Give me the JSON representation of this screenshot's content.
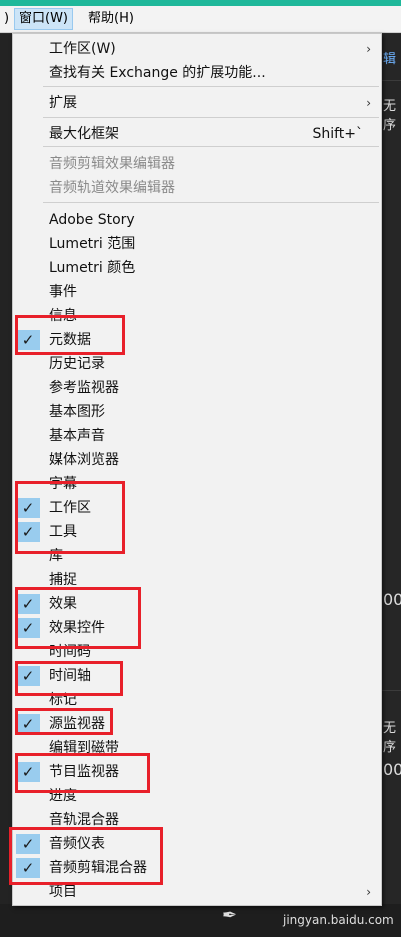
{
  "menubar": {
    "left_fragment": ")",
    "window_menu": "窗口(W)",
    "help_menu": "帮助(H)"
  },
  "background": {
    "right_edge_texts": [
      "辑",
      "无序",
      "00",
      "无序",
      "00"
    ]
  },
  "menu": {
    "items": [
      {
        "label": "工作区(W)",
        "submenu": true
      },
      {
        "label": "查找有关 Exchange 的扩展功能..."
      },
      {
        "label": "扩展",
        "submenu": true
      },
      {
        "label": "最大化框架",
        "shortcut": "Shift+`"
      },
      {
        "label": "音频剪辑效果编辑器",
        "disabled": true
      },
      {
        "label": "音频轨道效果编辑器",
        "disabled": true
      },
      {
        "label": "Adobe Story"
      },
      {
        "label": "Lumetri 范围"
      },
      {
        "label": "Lumetri 颜色"
      },
      {
        "label": "事件"
      },
      {
        "label": "信息"
      },
      {
        "label": "元数据",
        "checked": true
      },
      {
        "label": "历史记录"
      },
      {
        "label": "参考监视器"
      },
      {
        "label": "基本图形"
      },
      {
        "label": "基本声音"
      },
      {
        "label": "媒体浏览器"
      },
      {
        "label": "字幕"
      },
      {
        "label": "工作区",
        "checked": true
      },
      {
        "label": "工具",
        "checked": true
      },
      {
        "label": "库"
      },
      {
        "label": "捕捉"
      },
      {
        "label": "效果",
        "checked": true
      },
      {
        "label": "效果控件",
        "checked": true
      },
      {
        "label": "时间码"
      },
      {
        "label": "时间轴",
        "checked": true
      },
      {
        "label": "标记"
      },
      {
        "label": "源监视器",
        "checked": true
      },
      {
        "label": "编辑到磁带"
      },
      {
        "label": "节目监视器",
        "checked": true
      },
      {
        "label": "进度"
      },
      {
        "label": "音轨混合器"
      },
      {
        "label": "音频仪表",
        "checked": true
      },
      {
        "label": "音频剪辑混合器",
        "checked": true
      },
      {
        "label": "项目",
        "submenu": true
      }
    ],
    "submenu_glyph": "›",
    "check_glyph": "✓"
  },
  "colors": {
    "highlight": "#e8202a",
    "check_bg": "#99ccee",
    "menu_bg": "#f2f2f2"
  },
  "watermark": "jingyan.baidu.com"
}
